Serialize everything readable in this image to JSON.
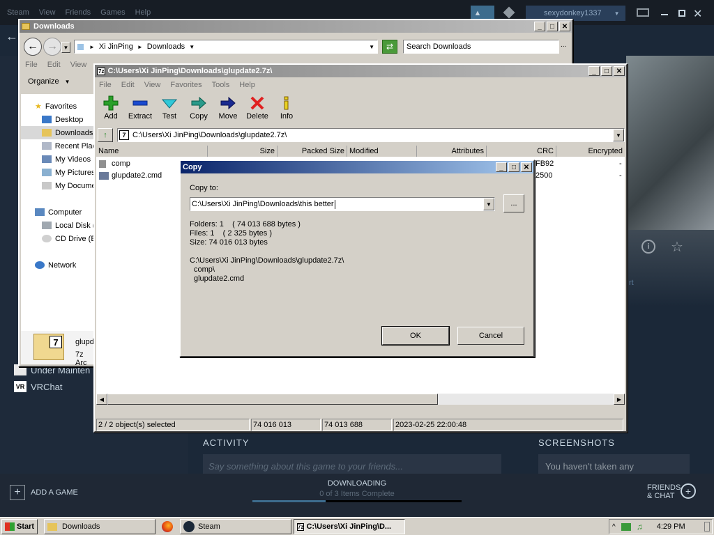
{
  "steam": {
    "menu": [
      "Steam",
      "View",
      "Friends",
      "Games",
      "Help"
    ],
    "username": "sexydonkey1337",
    "left_items": [
      {
        "label": "Under Mainten"
      },
      {
        "label": "VRChat"
      }
    ],
    "activity": "ACTIVITY",
    "activity_placeholder": "Say something about this game to your friends...",
    "screenshots": "SCREENSHOTS",
    "screenshots_empty": "You haven't taken any",
    "add_game": "ADD A GAME",
    "downloading": "DOWNLOADING",
    "downloading_sub": "0 of 3 Items Complete",
    "download_progress": 0.0,
    "friends": "FRIENDS",
    "chat": "& CHAT",
    "hero_side_text": "rt"
  },
  "explorer": {
    "title": "Downloads",
    "crumbs": [
      "Xi JinPing",
      "Downloads"
    ],
    "search_placeholder": "Search Downloads",
    "menu": [
      "File",
      "Edit",
      "View"
    ],
    "organize": "Organize",
    "nav": [
      {
        "label": "Favorites",
        "icon": "star-icon"
      },
      {
        "label": "Desktop",
        "icon": "desktop-icon"
      },
      {
        "label": "Downloads",
        "icon": "folder-icon"
      },
      {
        "label": "Recent Plac",
        "icon": "recent-icon"
      },
      {
        "label": "My Videos",
        "icon": "videos-icon"
      },
      {
        "label": "My Pictures",
        "icon": "pictures-icon"
      },
      {
        "label": "My Docume",
        "icon": "documents-icon"
      },
      {
        "label": "Computer",
        "icon": "computer-icon"
      },
      {
        "label": "Local Disk (",
        "icon": "disk-icon"
      },
      {
        "label": "CD Drive (E",
        "icon": "cd-icon"
      },
      {
        "label": "Network",
        "icon": "network-icon"
      }
    ],
    "detail_name": "glupd",
    "detail_type": "7z Arc",
    "detail_icon_text": "7"
  },
  "sevenzip": {
    "title": "C:\\Users\\Xi JinPing\\Downloads\\glupdate2.7z\\",
    "menu": [
      "File",
      "Edit",
      "View",
      "Favorites",
      "Tools",
      "Help"
    ],
    "tools": [
      {
        "label": "Add",
        "icon": "add-icon"
      },
      {
        "label": "Extract",
        "icon": "extract-icon"
      },
      {
        "label": "Test",
        "icon": "test-icon"
      },
      {
        "label": "Copy",
        "icon": "copy-icon"
      },
      {
        "label": "Move",
        "icon": "move-icon"
      },
      {
        "label": "Delete",
        "icon": "delete-icon"
      },
      {
        "label": "Info",
        "icon": "info-icon"
      }
    ],
    "path": "C:\\Users\\Xi JinPing\\Downloads\\glupdate2.7z\\",
    "columns": [
      "Name",
      "Size",
      "Packed Size",
      "Modified",
      "Attributes",
      "CRC",
      "Encrypted"
    ],
    "rows": [
      {
        "name": "comp",
        "crc": "FB92",
        "encrypted": "-"
      },
      {
        "name": "glupdate2.cmd",
        "crc": "2500",
        "encrypted": "-"
      }
    ],
    "status": {
      "selected": "2 / 2 object(s) selected",
      "size": "74 016 013",
      "packed": "74 013 688",
      "modified": "2023-02-25 22:00:48"
    },
    "logo": "7z"
  },
  "copy_dialog": {
    "title": "Copy",
    "copy_to_label": "Copy to:",
    "dest": "C:\\Users\\Xi JinPing\\Downloads\\this better",
    "browse": "...",
    "folders": "Folders: 1    ( 74 013 688 bytes )",
    "files": "Files: 1    ( 2 325 bytes )",
    "size": "Size: 74 016 013 bytes",
    "source": "C:\\Users\\Xi JinPing\\Downloads\\glupdate2.7z\\",
    "items": [
      "comp\\",
      "glupdate2.cmd"
    ],
    "ok": "OK",
    "cancel": "Cancel"
  },
  "taskbar": {
    "start": "Start",
    "buttons": [
      "Downloads",
      "Steam",
      "C:\\Users\\Xi JinPing\\D..."
    ],
    "time": "4:29 PM"
  }
}
